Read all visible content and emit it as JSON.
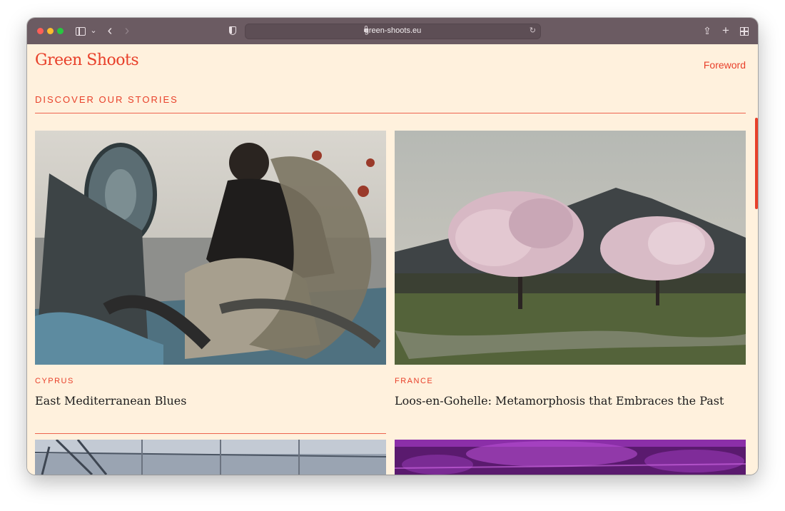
{
  "browser": {
    "url": "green-shoots.eu",
    "icons": [
      "sidebar-icon",
      "chevron-down-icon",
      "back-icon",
      "forward-icon",
      "shield-icon",
      "lock-icon",
      "reload-icon",
      "share-icon",
      "new-tab-icon",
      "tab-overview-icon"
    ],
    "glyphs": {
      "chevron": "⌄",
      "back": "‹",
      "forward": "›",
      "reload": "↻",
      "share": "⇪",
      "plus": "+"
    }
  },
  "site": {
    "logo": "Green Shoots",
    "nav_foreword": "Foreword",
    "section_title": "DISCOVER OUR STORIES",
    "accent_color": "#e8402a",
    "background_color": "#fff1dd"
  },
  "stories": [
    {
      "country": "CYPRUS",
      "title": "East Mediterranean Blues"
    },
    {
      "country": "FRANCE",
      "title": "Loos-en-Gohelle: Metamorphosis that Embraces the Past"
    }
  ]
}
